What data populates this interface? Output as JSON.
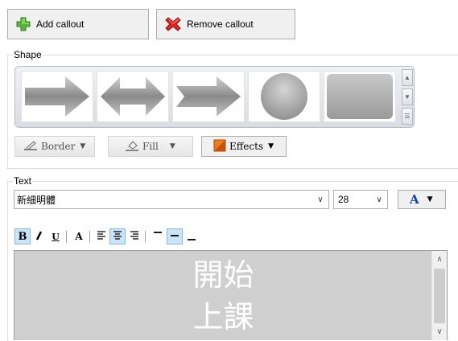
{
  "toolbar": {
    "add_label": "Add callout",
    "remove_label": "Remove callout"
  },
  "shape": {
    "legend": "Shape",
    "shapes": [
      "arrow-right-icon",
      "arrow-left-right-icon",
      "chevron-arrow-icon",
      "circle-icon",
      "rounded-rectangle-icon"
    ],
    "border_label": "Border",
    "fill_label": "Fill",
    "effects_label": "Effects"
  },
  "text": {
    "legend": "Text",
    "font_name": "新細明體",
    "font_size": "28",
    "font_color_glyph": "A",
    "font_color": "#1a3fa8",
    "format": {
      "bold": "B",
      "italic": "I",
      "underline": "U",
      "font_a": "A"
    },
    "content_line1": "開始",
    "content_line2": "上課"
  },
  "colors": {
    "add_icon": "#4caf2a",
    "remove_icon": "#d9201c",
    "effects_icon": "#e86a10",
    "editor_bg": "#cfcfcf",
    "active_button": "#cce4f7"
  }
}
